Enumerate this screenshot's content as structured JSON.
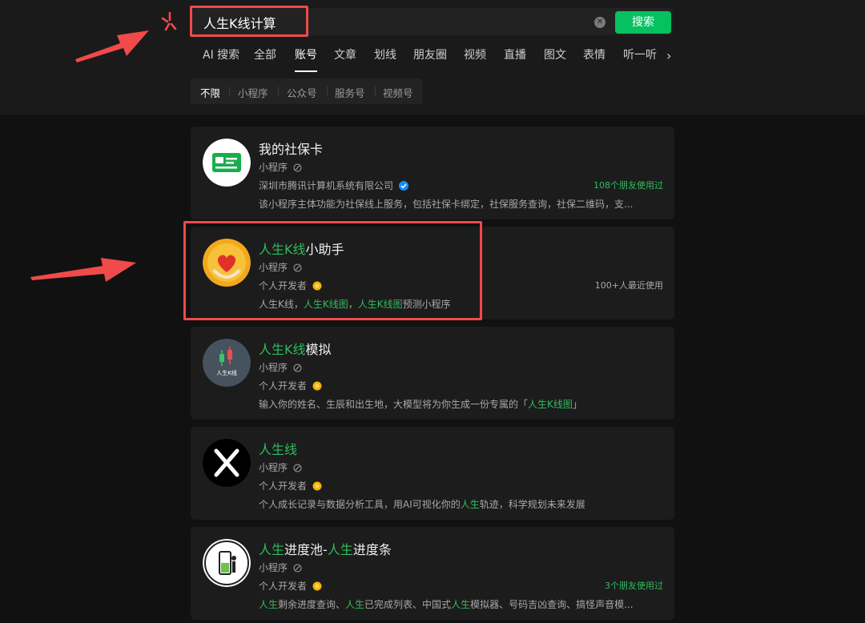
{
  "search": {
    "query": "人生K线计算",
    "button": "搜索"
  },
  "tabs": [
    "AI 搜索",
    "全部",
    "账号",
    "文章",
    "划线",
    "朋友圈",
    "视频",
    "直播",
    "图文",
    "表情",
    "听一听"
  ],
  "active_tab": "账号",
  "filters": [
    "不限",
    "小程序",
    "公众号",
    "服务号",
    "视频号"
  ],
  "active_filter": "不限",
  "colors": {
    "accent": "#07c160",
    "highlight_text": "#2ebd5c",
    "annotation": "#f04a4a",
    "verified": "#1a8cff",
    "developer_badge": "#f5b400"
  },
  "results": [
    {
      "title_parts": [
        {
          "text": "我的社保卡",
          "hl": false
        }
      ],
      "type": "小程序",
      "developer": "深圳市腾讯计算机系统有限公司",
      "developer_badge": "verified-icon",
      "side_note": "108个朋友使用过",
      "desc_parts": [
        {
          "text": "该小程序主体功能为社保线上服务，包括社保卡绑定，社保服务查询，社保二维码，支...",
          "hl": false
        }
      ]
    },
    {
      "title_parts": [
        {
          "text": "人生K线",
          "hl": true
        },
        {
          "text": "小助手",
          "hl": false
        }
      ],
      "type": "小程序",
      "developer": "个人开发者",
      "developer_badge": "personal-developer-icon",
      "side_note": "100+人最近使用",
      "desc_parts": [
        {
          "text": "人生K线，",
          "hl": false
        },
        {
          "text": "人生K线图",
          "hl": true
        },
        {
          "text": "，",
          "hl": false
        },
        {
          "text": "人生K线图",
          "hl": true
        },
        {
          "text": "预测小程序",
          "hl": false
        }
      ]
    },
    {
      "title_parts": [
        {
          "text": "人生K线",
          "hl": true
        },
        {
          "text": "模拟",
          "hl": false
        }
      ],
      "type": "小程序",
      "developer": "个人开发者",
      "developer_badge": "personal-developer-icon",
      "side_note": "",
      "avatar_label": "人生K线",
      "desc_parts": [
        {
          "text": "输入你的姓名、生辰和出生地，大模型将为你生成一份专属的「",
          "hl": false
        },
        {
          "text": "人生K线图",
          "hl": true
        },
        {
          "text": "」",
          "hl": false
        }
      ]
    },
    {
      "title_parts": [
        {
          "text": "人生线",
          "hl": true
        }
      ],
      "type": "小程序",
      "developer": "个人开发者",
      "developer_badge": "personal-developer-icon",
      "side_note": "",
      "desc_parts": [
        {
          "text": "个人成长记录与数据分析工具，用AI可视化你的",
          "hl": false
        },
        {
          "text": "人生",
          "hl": true
        },
        {
          "text": "轨迹，科学规划未来发展",
          "hl": false
        }
      ]
    },
    {
      "title_parts": [
        {
          "text": "人生",
          "hl": true
        },
        {
          "text": "进度池-",
          "hl": false
        },
        {
          "text": "人生",
          "hl": true
        },
        {
          "text": "进度条",
          "hl": false
        }
      ],
      "type": "小程序",
      "developer": "个人开发者",
      "developer_badge": "personal-developer-icon",
      "side_note": "3个朋友使用过",
      "desc_parts": [
        {
          "text": "人生",
          "hl": true
        },
        {
          "text": "剩余进度查询、",
          "hl": false
        },
        {
          "text": "人生",
          "hl": true
        },
        {
          "text": "已完成列表、中国式",
          "hl": false
        },
        {
          "text": "人生",
          "hl": true
        },
        {
          "text": "模拟器、号码吉凶查询、搞怪声音模...",
          "hl": false
        }
      ]
    }
  ]
}
